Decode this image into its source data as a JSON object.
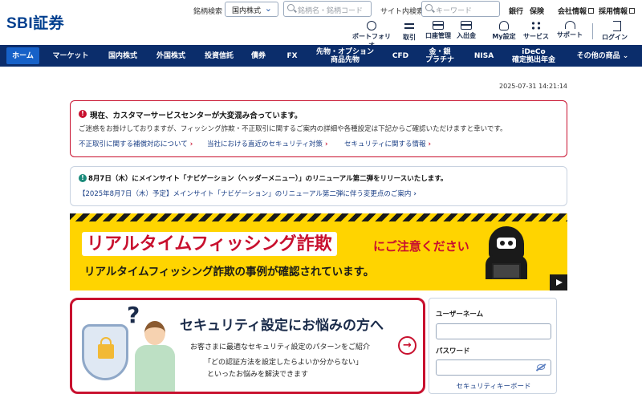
{
  "brand": {
    "logo_text": "SBI証券",
    "primary_color": "#0b2d6b",
    "accent_red": "#c8102e",
    "active_tab_color": "#1661c8"
  },
  "header": {
    "ticker_label": "銘柄検索",
    "market_select": "国内株式",
    "ticker_placeholder": "銘柄名・銘柄コード",
    "site_search_label": "サイト内検索",
    "site_search_placeholder": "キーワード",
    "top_links": [
      {
        "label": "銀行"
      },
      {
        "label": "保険"
      },
      {
        "label": "会社情報"
      },
      {
        "label": "採用情報"
      }
    ],
    "utility": [
      {
        "label": "ポートフォリオ",
        "icon": "portfolio-icon"
      },
      {
        "label": "取引",
        "icon": "trade-arrows-icon"
      },
      {
        "label": "口座管理",
        "icon": "account-card-icon"
      },
      {
        "label": "入出金",
        "icon": "deposit-icon"
      },
      {
        "label": "My設定",
        "icon": "my-settings-icon"
      },
      {
        "label": "サービス",
        "icon": "services-grid-icon"
      },
      {
        "label": "サポート",
        "icon": "support-headset-icon"
      },
      {
        "label": "ログイン",
        "icon": "login-icon"
      }
    ]
  },
  "nav": [
    {
      "label": "ホーム",
      "active": true
    },
    {
      "label": "マーケット"
    },
    {
      "label": "国内株式"
    },
    {
      "label": "外国株式"
    },
    {
      "label": "投資信託"
    },
    {
      "label": "債券"
    },
    {
      "label": "FX"
    },
    {
      "label": "先物・オプション\n商品先物"
    },
    {
      "label": "CFD"
    },
    {
      "label": "金・銀\nプラチナ"
    },
    {
      "label": "NISA"
    },
    {
      "label": "iDeCo\n確定拠出年金"
    },
    {
      "label": "その他の商品 ⌄"
    }
  ],
  "timestamp": "2025-07-31 14:21:14",
  "notice_red": {
    "icon": "!",
    "title": "現在、カスタマーサービスセンターが大変混み合っています。",
    "text": "ご迷惑をお掛けしておりますが、フィッシング詐欺・不正取引に関するご案内の詳細や各種設定は下記からご確認いただけますと幸いです。",
    "links": [
      "不正取引に関する補償対応について",
      "当社における直近のセキュリティ対策",
      "セキュリティに関する情報"
    ]
  },
  "notice_blue": {
    "icon": "!",
    "title": "8月7日（木）にメインサイト「ナビゲーション（ヘッダーメニュー）」のリニューアル第二弾をリリースいたします。",
    "link": "【2025年8月7日（木）予定】メインサイト「ナビゲーション」のリニューアル第二弾に伴う変更点のご案内"
  },
  "banner": {
    "main": "リアルタイムフィッシング詐欺",
    "note": "にご注意ください",
    "sub": "リアルタイムフィッシング詐欺の事例が確認されています。"
  },
  "security_card": {
    "qmark": "?",
    "title": "セキュリティ設定にお悩みの方へ",
    "text1": "お客さまに最適なセキュリティ設定のパターンをご紹介",
    "text2": "「どの認証方法を設定したらよいか分からない」",
    "text3": "といったお悩みを解決できます"
  },
  "login": {
    "username_label": "ユーザーネーム",
    "password_label": "パスワード",
    "keyboard_link": "セキュリティキーボード"
  }
}
